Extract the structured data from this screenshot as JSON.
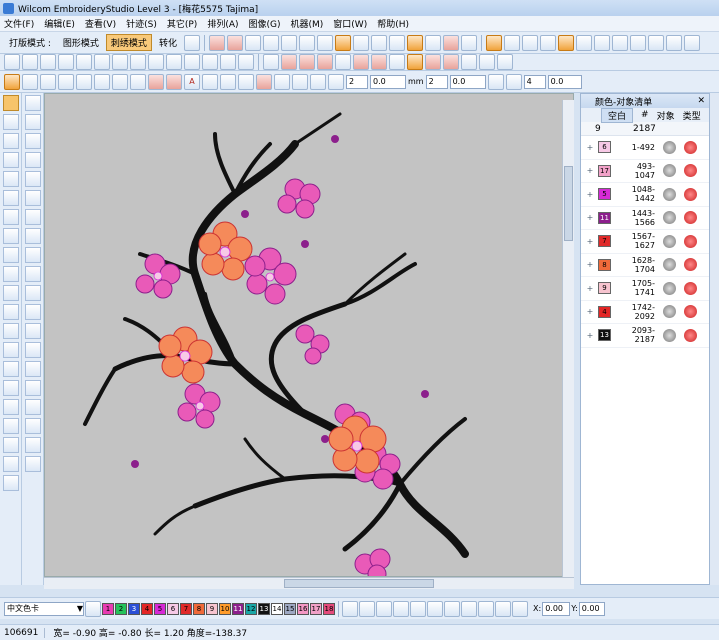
{
  "window": {
    "title": "Wilcom EmbroideryStudio Level 3 - [梅花5575          Tajima]"
  },
  "menu": [
    "文件(F)",
    "编辑(E)",
    "查看(V)",
    "针迹(S)",
    "其它(P)",
    "排列(A)",
    "图像(G)",
    "机器(M)",
    "窗口(W)",
    "帮助(H)"
  ],
  "toolbar1": {
    "mode_label": "打版模式 :",
    "modes": [
      "图形模式",
      "刺绣模式",
      "转化"
    ],
    "active_mode": "刺绣模式"
  },
  "toolbar3": {
    "inputs": [
      "2",
      "0.0",
      "2",
      "0.0",
      "4",
      "0.0"
    ],
    "unit": "mm"
  },
  "panel": {
    "title": "颜色-对象清单",
    "tab": "空白",
    "head_hash": "#",
    "head_obj": "对象",
    "head_type": "类型",
    "summary_num": "9",
    "summary_range": "2187",
    "rows": [
      {
        "num": "6",
        "color": "#f7c9e6",
        "range": "1-492"
      },
      {
        "num": "17",
        "color": "#f2a1c8",
        "range": "493-1047"
      },
      {
        "num": "5",
        "color": "#d62ad6",
        "range": "1048-1442"
      },
      {
        "num": "11",
        "color": "#8c1f8c",
        "range": "1443-1566"
      },
      {
        "num": "7",
        "color": "#e02a2a",
        "range": "1567-1627"
      },
      {
        "num": "8",
        "color": "#f06a3a",
        "range": "1628-1704"
      },
      {
        "num": "9",
        "color": "#f7c4cf",
        "range": "1705-1741"
      },
      {
        "num": "4",
        "color": "#e32626",
        "range": "1742-2092"
      },
      {
        "num": "13",
        "color": "#111111",
        "range": "2093-2187"
      }
    ]
  },
  "palette": {
    "combo": "中文色卡",
    "chips": [
      {
        "n": "1",
        "c": "#e83bb2"
      },
      {
        "n": "2",
        "c": "#25c25a"
      },
      {
        "n": "3",
        "c": "#2b4fd6"
      },
      {
        "n": "4",
        "c": "#e32626"
      },
      {
        "n": "5",
        "c": "#d62ad6"
      },
      {
        "n": "6",
        "c": "#f7c9e6"
      },
      {
        "n": "7",
        "c": "#e02a2a"
      },
      {
        "n": "8",
        "c": "#f06a3a"
      },
      {
        "n": "9",
        "c": "#f7c4cf"
      },
      {
        "n": "10",
        "c": "#ff9c2b"
      },
      {
        "n": "11",
        "c": "#8c1f8c"
      },
      {
        "n": "12",
        "c": "#1aa7a7"
      },
      {
        "n": "13",
        "c": "#111111"
      },
      {
        "n": "14",
        "c": "#ffffff"
      },
      {
        "n": "15",
        "c": "#9ea8c2"
      },
      {
        "n": "16",
        "c": "#f497c4"
      },
      {
        "n": "17",
        "c": "#f2a1c8"
      },
      {
        "n": "18",
        "c": "#e54b7c"
      }
    ],
    "xy_labels": [
      "X:",
      "Y:"
    ],
    "xy_values": [
      "0.00",
      "0.00"
    ]
  },
  "status": {
    "count": "106691",
    "dims": "宽= -0.90 高= -0.80 长= 1.20 角度=-138.37"
  }
}
